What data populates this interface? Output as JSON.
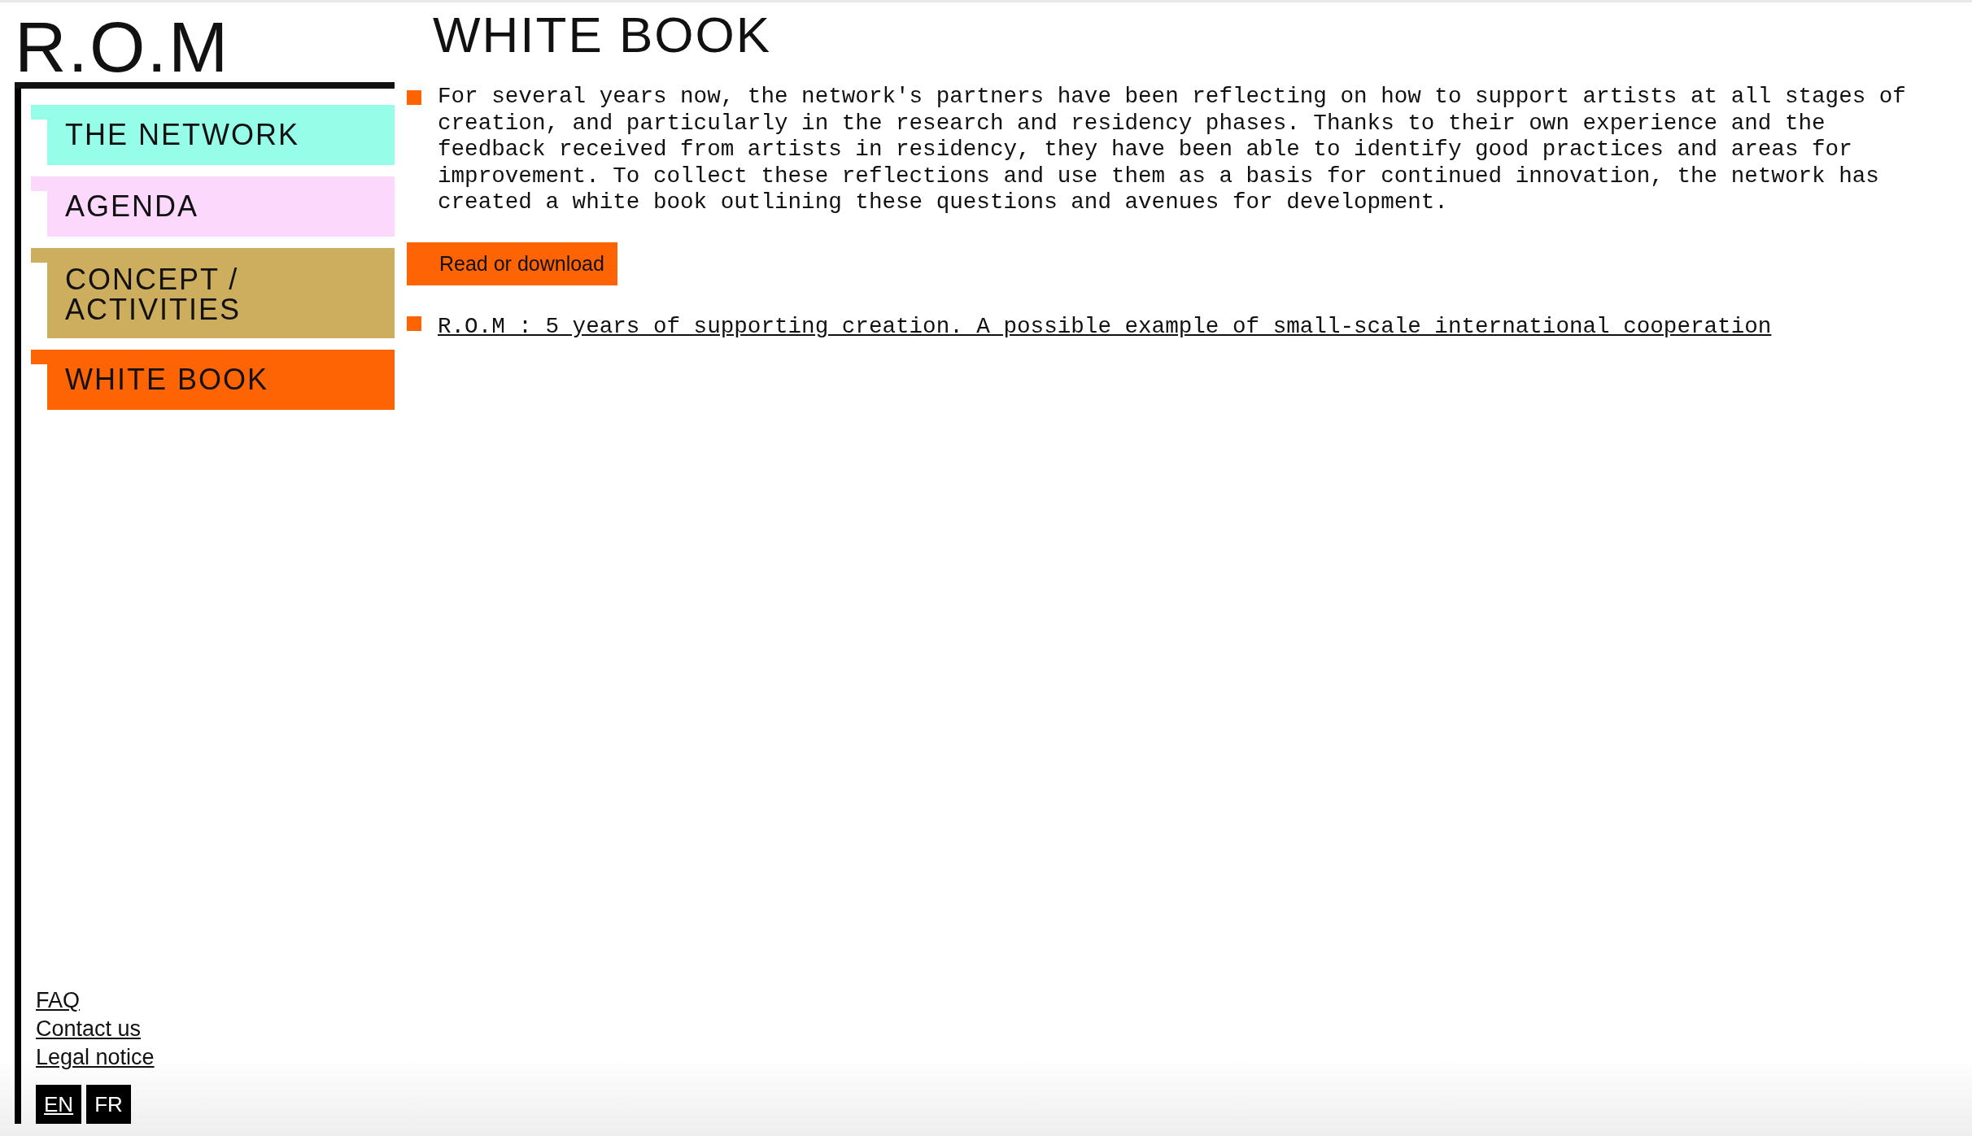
{
  "logo": "R.O.M",
  "nav": [
    {
      "label": "THE NETWORK",
      "color": "#96fde9"
    },
    {
      "label": "AGENDA",
      "color": "#fcd9fc"
    },
    {
      "label": "CONCEPT / ACTIVITIES",
      "color": "#cdad5e"
    },
    {
      "label": "WHITE BOOK",
      "color": "#ff6404"
    }
  ],
  "footer_links": [
    "FAQ",
    "Contact us",
    "Legal notice"
  ],
  "languages": [
    {
      "label": "EN",
      "selected": true
    },
    {
      "label": "FR",
      "selected": false
    }
  ],
  "heading": "WHITE BOOK",
  "intro": "For several years now, the network's partners have been reflecting on how to support artists at all stages of creation, and particularly in the research and residency phases. Thanks to their own experience and the feedback received from artists in residency, they have been able to identify good practices and areas for improvement. To collect these reflections and use them as a basis for continued innovation, the network has created a white book outlining these questions and avenues for development.",
  "button": "Read or download",
  "link": "R.O.M : 5 years of supporting creation. A possible example of small-scale international cooperation"
}
